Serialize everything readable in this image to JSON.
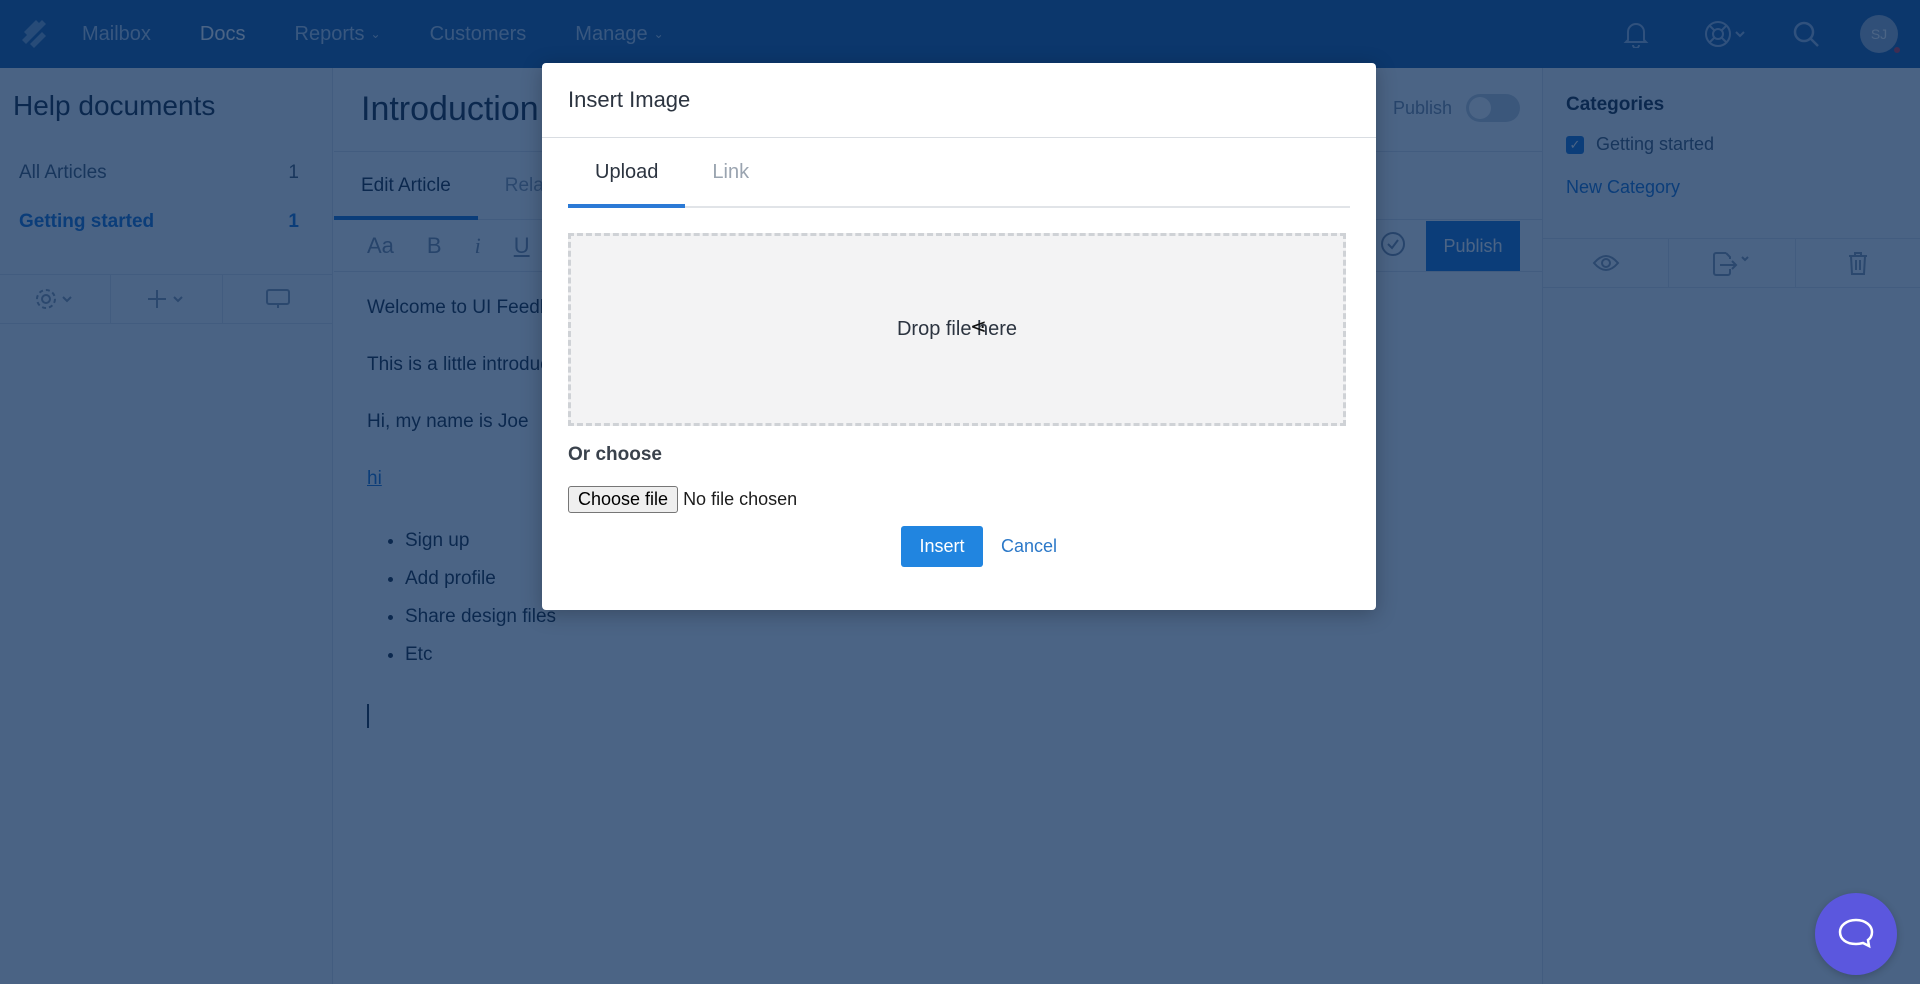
{
  "topnav": {
    "logo_icon": "helpscout-logo-icon",
    "items": [
      {
        "label": "Mailbox",
        "active": false,
        "dropdown": false
      },
      {
        "label": "Docs",
        "active": true,
        "dropdown": false
      },
      {
        "label": "Reports",
        "active": false,
        "dropdown": true
      },
      {
        "label": "Customers",
        "active": false,
        "dropdown": false
      },
      {
        "label": "Manage",
        "active": false,
        "dropdown": true
      }
    ],
    "icons": [
      "bell-icon",
      "help-lifebuoy-icon",
      "search-icon"
    ],
    "avatar_initials": "SJ"
  },
  "sidebar": {
    "title": "Help documents",
    "items": [
      {
        "label": "All Articles",
        "count": "1",
        "active": false
      },
      {
        "label": "Getting started",
        "count": "1",
        "active": true
      }
    ],
    "tools": [
      "gear-icon",
      "plus-icon",
      "monitor-icon"
    ]
  },
  "article": {
    "title": "Introduction",
    "publish_toggle_label": "Publish",
    "publish_toggle_on": false,
    "tabs": [
      {
        "label": "Edit Article",
        "active": true
      },
      {
        "label": "Related",
        "active": false
      }
    ],
    "format_buttons": [
      "Aa",
      "B",
      "i",
      "U"
    ],
    "publish_button": "Publish",
    "body": {
      "paragraphs": [
        "Welcome to UI Feedback",
        "This is a little introduction",
        "Hi, my name is Joe"
      ],
      "link": "hi",
      "list": [
        "Sign up",
        "Add profile",
        "Share design files",
        "Etc"
      ]
    }
  },
  "rightbar": {
    "title": "Categories",
    "categories": [
      {
        "label": "Getting started",
        "checked": true
      }
    ],
    "new_category": "New Category",
    "tools": [
      "eye-icon",
      "export-icon",
      "trash-icon"
    ]
  },
  "modal": {
    "title": "Insert Image",
    "tabs": [
      {
        "label": "Upload",
        "active": true
      },
      {
        "label": "Link",
        "active": false
      }
    ],
    "dropzone_text": "Drop file here",
    "or_choose": "Or choose",
    "file_button": "Choose file",
    "file_status": "No file chosen",
    "insert_button": "Insert",
    "cancel_link": "Cancel"
  },
  "colors": {
    "nav_bg": "#1f5fa6",
    "accent": "#1c74d4",
    "insert_button": "#2185e0",
    "beacon": "#5b57de",
    "overlay": "rgba(6,40,86,0.72)"
  },
  "beacon": {
    "icon": "chat-bubble-icon"
  }
}
